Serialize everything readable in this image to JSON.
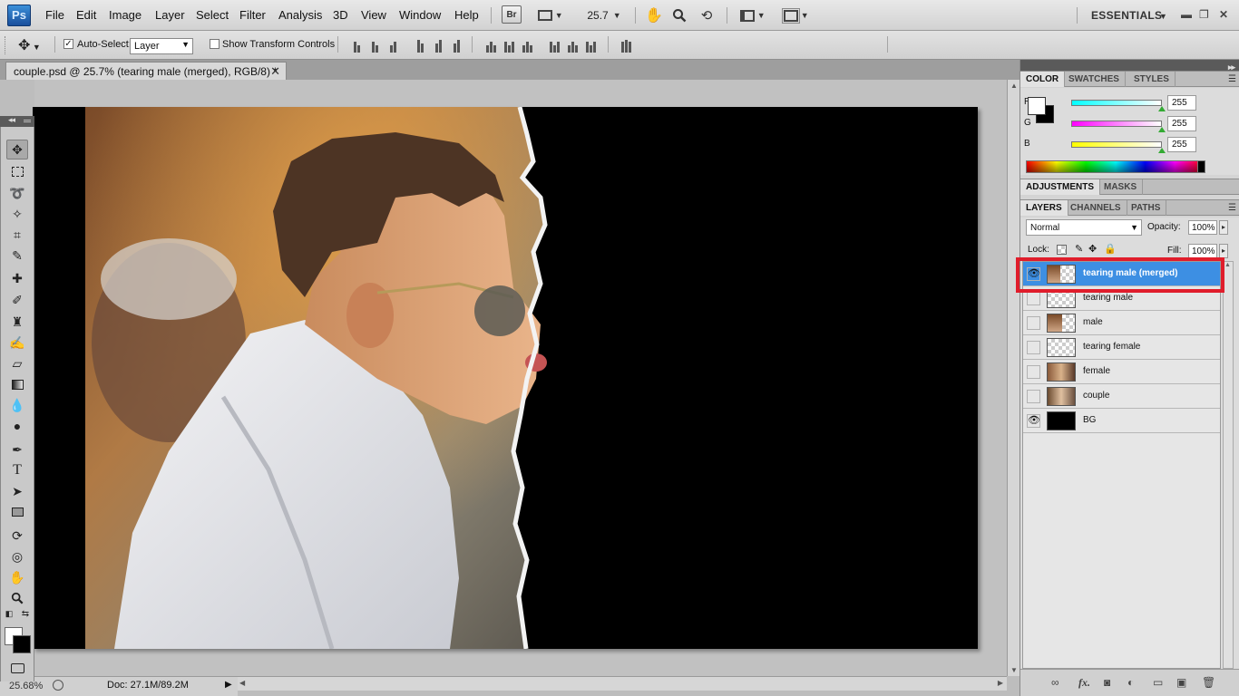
{
  "menubar": {
    "logo": "Ps",
    "items": [
      "File",
      "Edit",
      "Image",
      "Layer",
      "Select",
      "Filter",
      "Analysis",
      "3D",
      "View",
      "Window",
      "Help"
    ],
    "bridge_label": "Br",
    "zoom": "25.7",
    "workspace": "ESSENTIALS"
  },
  "options": {
    "auto_select_checked": true,
    "auto_select_label": "Auto-Select:",
    "auto_select_value": "Layer",
    "show_transform_checked": false,
    "show_transform_label": "Show Transform Controls"
  },
  "document": {
    "tab_title": "couple.psd @ 25.7% (tearing male (merged), RGB/8) *",
    "status_zoom": "25.68%",
    "status_doc": "Doc: 27.1M/89.2M"
  },
  "colors": {
    "accent": "#3d8fe3",
    "highlight": "#e01d2b",
    "foreground": "#ffffff",
    "background": "#000000"
  },
  "color_panel": {
    "tabs": [
      "COLOR",
      "SWATCHES",
      "STYLES"
    ],
    "active_tab": "COLOR",
    "channels": [
      {
        "label": "R",
        "value": "255",
        "gradient": "linear-gradient(to right,#00ffff,#ffffff)"
      },
      {
        "label": "G",
        "value": "255",
        "gradient": "linear-gradient(to right,#ff00ff,#ffffff)"
      },
      {
        "label": "B",
        "value": "255",
        "gradient": "linear-gradient(to right,#ffff00,#ffffff)"
      }
    ]
  },
  "adjustments_panel": {
    "tabs": [
      "ADJUSTMENTS",
      "MASKS"
    ]
  },
  "layers_panel": {
    "tabs": [
      "LAYERS",
      "CHANNELS",
      "PATHS"
    ],
    "blend_mode": "Normal",
    "opacity_label": "Opacity:",
    "opacity": "100%",
    "lock_label": "Lock:",
    "fill_label": "Fill:",
    "fill": "100%",
    "layers": [
      {
        "name": "tearing male (merged)",
        "visible": true,
        "selected": true,
        "thumb": "photo-checker"
      },
      {
        "name": "tearing male",
        "visible": false,
        "selected": false,
        "thumb": "checker"
      },
      {
        "name": "male",
        "visible": false,
        "selected": false,
        "thumb": "photo-checker"
      },
      {
        "name": "tearing female",
        "visible": false,
        "selected": false,
        "thumb": "checker"
      },
      {
        "name": "female",
        "visible": false,
        "selected": false,
        "thumb": "photo"
      },
      {
        "name": "couple",
        "visible": false,
        "selected": false,
        "thumb": "photo"
      },
      {
        "name": "BG",
        "visible": true,
        "selected": false,
        "thumb": "black"
      }
    ],
    "footer_icons": [
      "link-icon",
      "fx-icon",
      "mask-icon",
      "adjustment-icon",
      "group-icon",
      "new-layer-icon",
      "trash-icon"
    ]
  },
  "tools": [
    "move-tool-icon",
    "marquee-tool-icon",
    "lasso-tool-icon",
    "magic-wand-tool-icon",
    "crop-tool-icon",
    "eyedropper-tool-icon",
    "healing-brush-tool-icon",
    "brush-tool-icon",
    "clone-stamp-tool-icon",
    "history-brush-tool-icon",
    "eraser-tool-icon",
    "gradient-tool-icon",
    "blur-tool-icon",
    "dodge-tool-icon",
    "pen-tool-icon",
    "type-tool-icon",
    "path-selection-tool-icon",
    "rectangle-tool-icon",
    "3d-rotate-tool-icon",
    "3d-orbit-tool-icon",
    "hand-tool-icon",
    "zoom-tool-icon",
    "quick-mask-icon"
  ]
}
